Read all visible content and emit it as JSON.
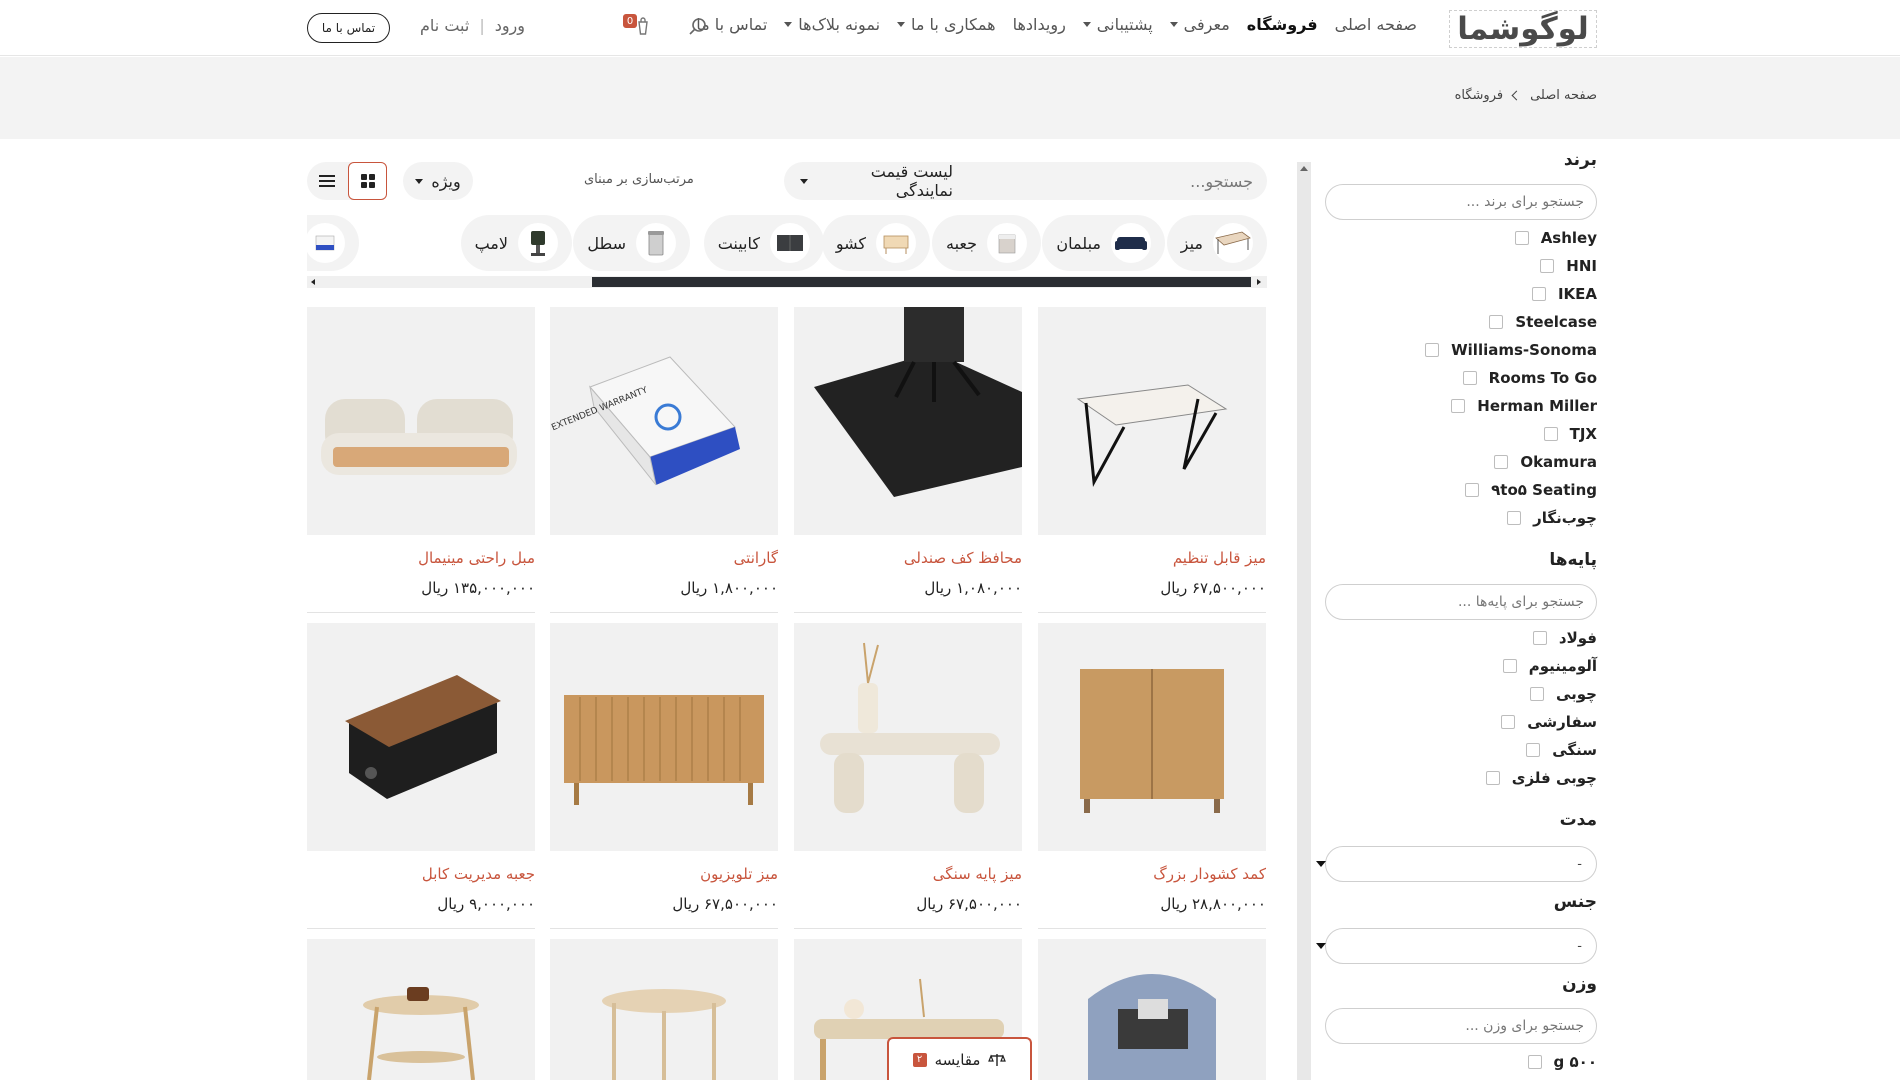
{
  "header": {
    "logo": "لوگوشما",
    "nav": [
      {
        "label": "صفحه اصلی",
        "dropdown": false,
        "active": false
      },
      {
        "label": "فروشگاه",
        "dropdown": false,
        "active": true
      },
      {
        "label": "معرفی",
        "dropdown": true,
        "active": false
      },
      {
        "label": "پشتیبانی",
        "dropdown": true,
        "active": false
      },
      {
        "label": "رویدادها",
        "dropdown": false,
        "active": false
      },
      {
        "label": "همکاری با ما",
        "dropdown": true,
        "active": false
      },
      {
        "label": "نمونه بلاک‌ها",
        "dropdown": true,
        "active": false
      },
      {
        "label": "تماس با ما",
        "dropdown": false,
        "active": false
      }
    ],
    "cart_count": "0",
    "login": "ورود",
    "register": "ثبت نام",
    "contact_button": "تماس با ما"
  },
  "breadcrumb": {
    "home": "صفحه اصلی",
    "current": "فروشگاه"
  },
  "filters": {
    "brand": {
      "title": "برند",
      "search_placeholder": "جستجو برای برند ...",
      "options": [
        "Ashley",
        "HNI",
        "IKEA",
        "Steelcase",
        "Williams-Sonoma",
        "Rooms To Go",
        "Herman Miller",
        "TJX",
        "Okamura",
        "۹to۵ Seating",
        "چوب‌نگار"
      ]
    },
    "legs": {
      "title": "پایه‌ها",
      "search_placeholder": "جستجو برای پایه‌ها ...",
      "options": [
        "فولاد",
        "آلومینیوم",
        "چوبی",
        "سفارشی",
        "سنگی",
        "چوبی فلزی"
      ]
    },
    "duration": {
      "title": "مدت",
      "value": "-"
    },
    "material": {
      "title": "جنس",
      "value": "-"
    },
    "weight": {
      "title": "وزن",
      "search_placeholder": "جستجو برای وزن ...",
      "options": [
        "۵۰۰ g"
      ]
    }
  },
  "toolbar": {
    "search_placeholder": "جستجو...",
    "pricelist": "لیست قیمت نمایندگی",
    "sort_label": "مرتب‌سازی بر مبنای",
    "sort_value": "ویژه"
  },
  "categories": [
    "میز",
    "مبلمان",
    "جعبه",
    "کشو",
    "کابینت",
    "سطل",
    "لامپ"
  ],
  "products": [
    {
      "name": "میز قابل تنظیم",
      "price": "۶۷,۵۰۰,۰۰۰ ریال"
    },
    {
      "name": "محافظ کف صندلی",
      "price": "۱,۰۸۰,۰۰۰ ریال"
    },
    {
      "name": "گارانتی",
      "price": "۱,۸۰۰,۰۰۰ ریال"
    },
    {
      "name": "مبل راحتی مینیمال",
      "price": "۱۳۵,۰۰۰,۰۰۰ ریال"
    },
    {
      "name": "کمد کشودار بزرگ",
      "price": "۲۸,۸۰۰,۰۰۰ ریال"
    },
    {
      "name": "میز پایه سنگی",
      "price": "۶۷,۵۰۰,۰۰۰ ریال"
    },
    {
      "name": "میز تلویزیون",
      "price": "۶۷,۵۰۰,۰۰۰ ریال"
    },
    {
      "name": "جعبه مدیریت کابل",
      "price": "۹,۰۰۰,۰۰۰ ریال"
    }
  ],
  "warranty_box_text": "EXTENDED WARRANTY",
  "compare": {
    "label": "مقایسه",
    "count": "۲"
  },
  "colors": {
    "accent": "#c8553d",
    "dark": "#2b2e33",
    "band": "#f3f3f3"
  }
}
